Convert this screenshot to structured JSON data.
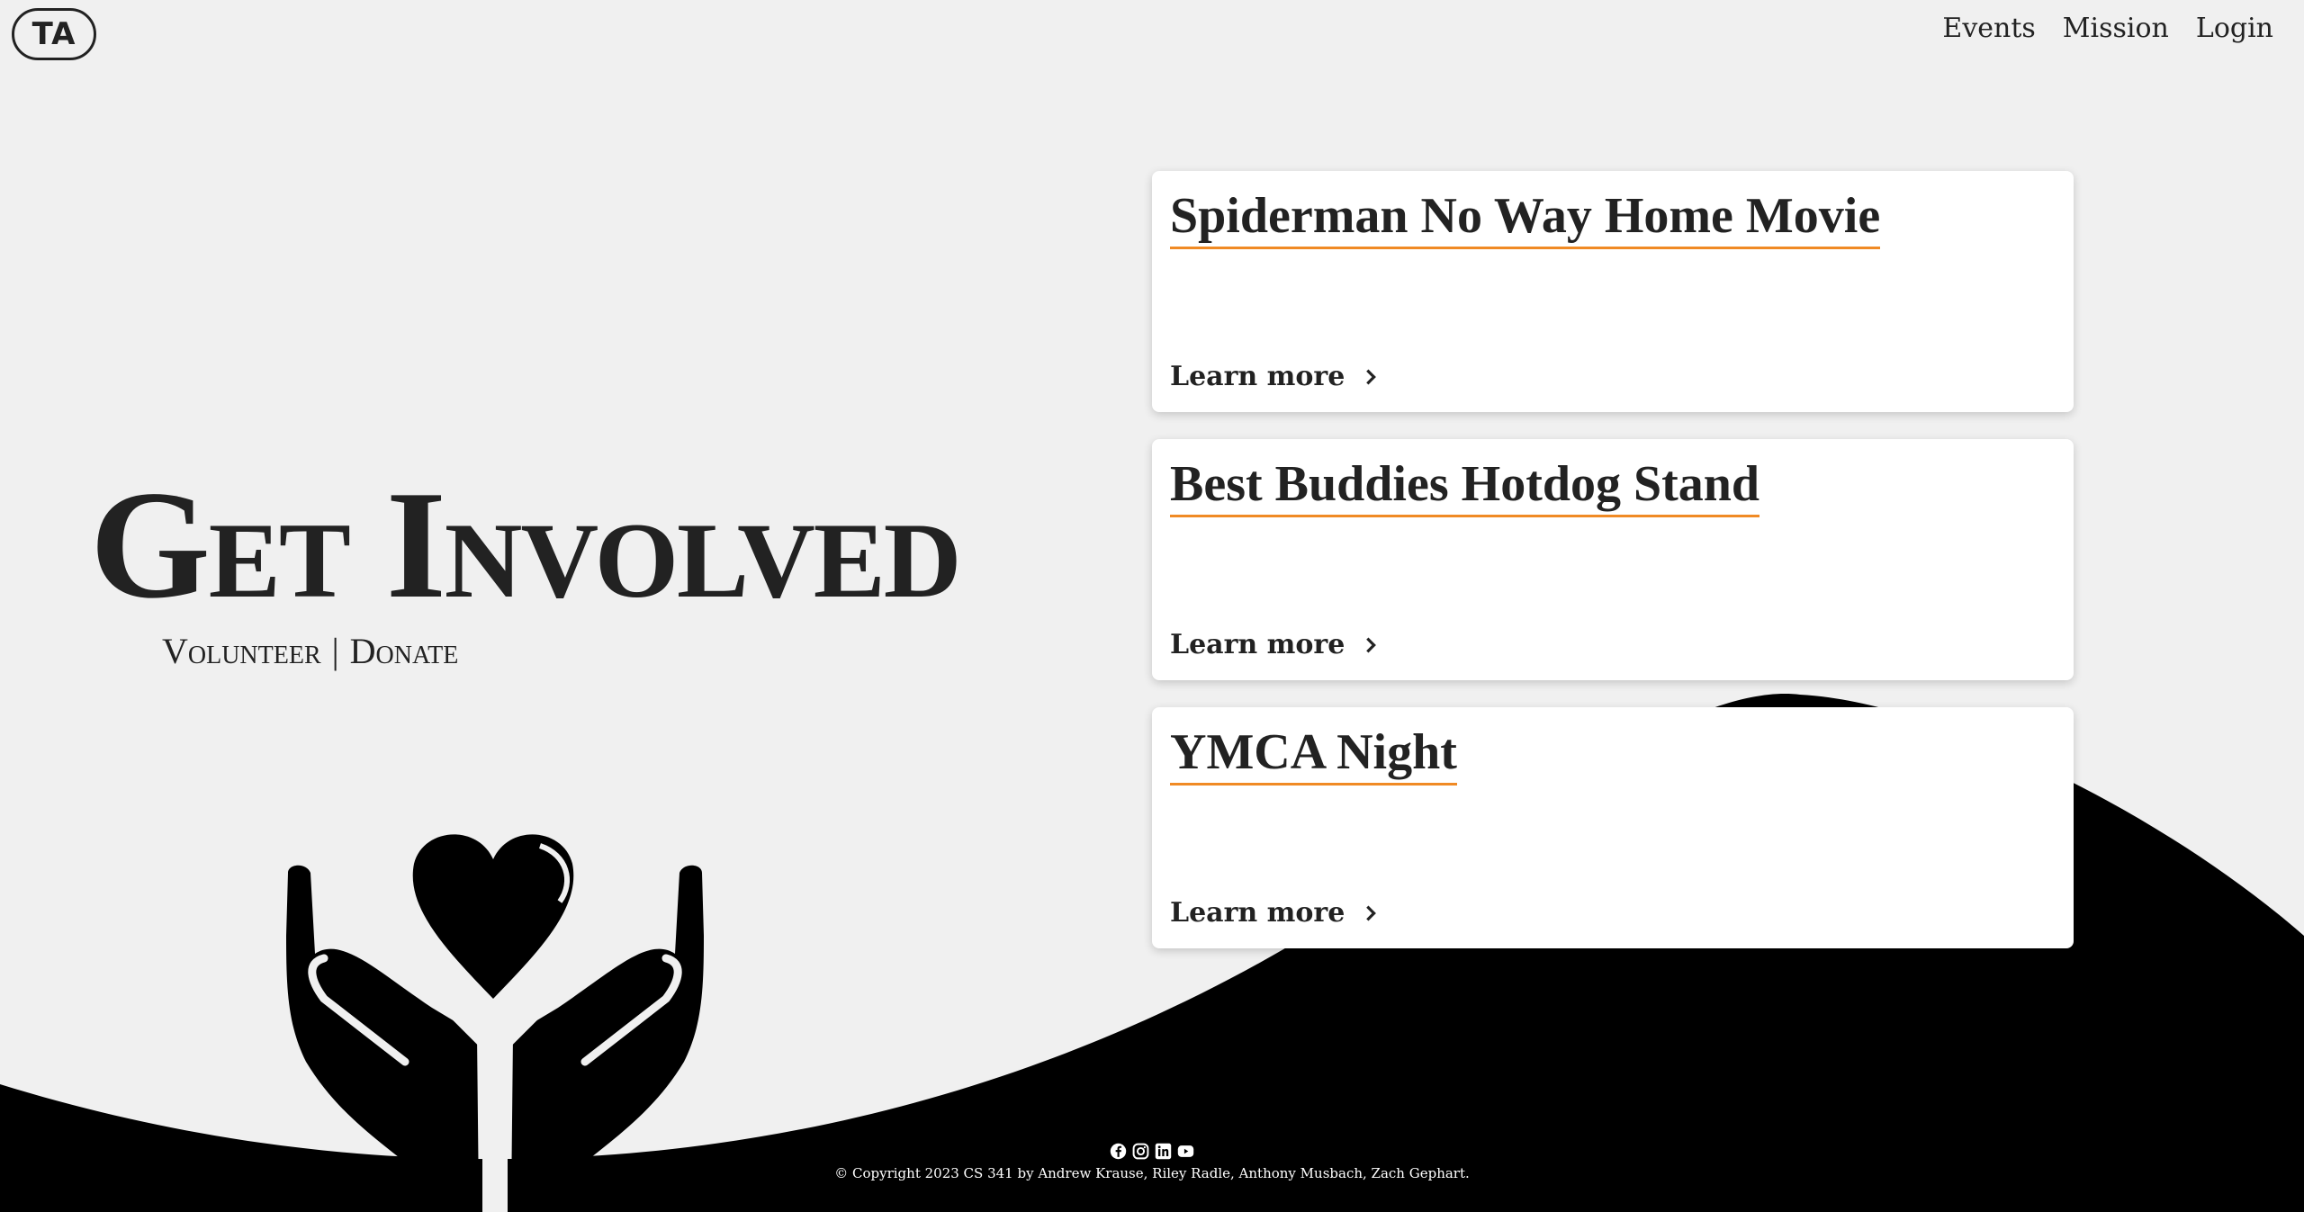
{
  "header": {
    "logo_text": "TA",
    "nav": [
      {
        "label": "Events"
      },
      {
        "label": "Mission"
      },
      {
        "label": "Login"
      }
    ]
  },
  "hero": {
    "title": "Get Involved",
    "subtitle_left": "Volunteer",
    "subtitle_sep": "|",
    "subtitle_right": "Donate"
  },
  "events": [
    {
      "title": "Spiderman No Way Home Movie",
      "link_label": "Learn more"
    },
    {
      "title": "Best Buddies Hotdog Stand",
      "link_label": "Learn more"
    },
    {
      "title": "YMCA Night",
      "link_label": "Learn more"
    }
  ],
  "footer": {
    "social_icons": [
      "facebook-icon",
      "instagram-icon",
      "linkedin-icon",
      "youtube-icon"
    ],
    "copyright": "© Copyright 2023 CS 341 by Andrew Krause, Riley Radle, Anthony Musbach, Zach Gephart."
  },
  "colors": {
    "background": "#f0f0f0",
    "accent_underline": "#f08a24",
    "dark": "#000000",
    "card": "#ffffff"
  }
}
